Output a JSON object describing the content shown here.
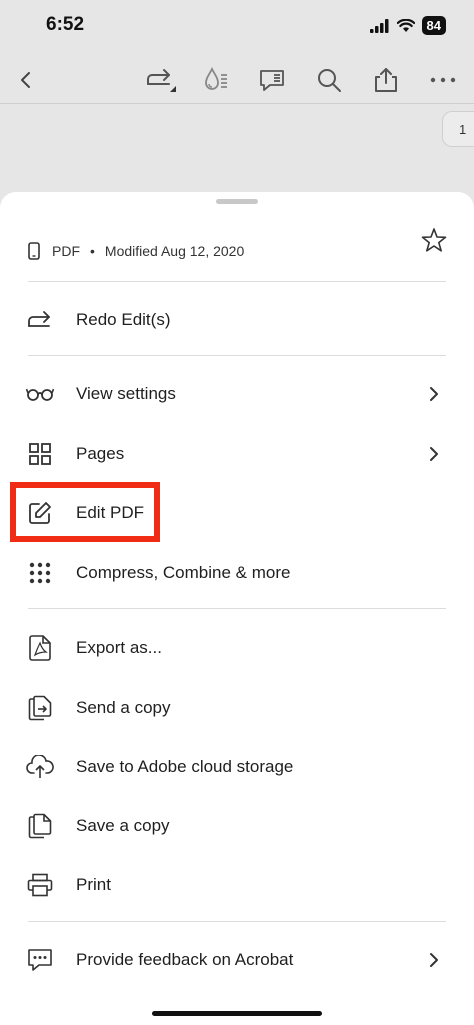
{
  "status_bar": {
    "time": "6:52",
    "battery": "84"
  },
  "toolbar": {
    "icons": [
      "back-icon",
      "redo-icon",
      "highlighter-icon",
      "comment-icon",
      "search-icon",
      "share-icon",
      "more-icon"
    ]
  },
  "page_indicator": "1",
  "sheet": {
    "file_type": "PDF",
    "separator": "•",
    "modified": "Modified Aug 12, 2020",
    "items": [
      {
        "label": "Redo Edit(s)",
        "icon": "redo-icon"
      },
      {
        "label": "View settings",
        "icon": "glasses-icon",
        "chevron": true
      },
      {
        "label": "Pages",
        "icon": "grid-icon",
        "chevron": true
      },
      {
        "label": "Edit PDF",
        "icon": "edit-icon",
        "highlighted": true
      },
      {
        "label": "Compress, Combine & more",
        "icon": "dots-grid-icon"
      },
      {
        "label": "Export as...",
        "icon": "export-pdf-icon"
      },
      {
        "label": "Send a copy",
        "icon": "send-copy-icon"
      },
      {
        "label": "Save to Adobe cloud storage",
        "icon": "cloud-upload-icon"
      },
      {
        "label": "Save a copy",
        "icon": "save-copy-icon"
      },
      {
        "label": "Print",
        "icon": "printer-icon"
      },
      {
        "label": "Provide feedback on Acrobat",
        "icon": "feedback-icon",
        "chevron": true
      }
    ]
  },
  "colors": {
    "highlight": "#f02d14",
    "sheet_bg": "#ffffff",
    "backdrop": "#e6e6e6"
  }
}
